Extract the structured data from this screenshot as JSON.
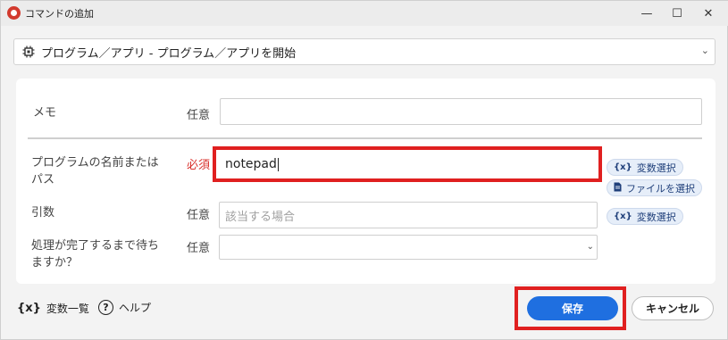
{
  "window": {
    "title": "コマンドの追加",
    "minimize_glyph": "—",
    "maximize_glyph": "☐",
    "close_glyph": "✕"
  },
  "command_select": {
    "icon": "chip-icon",
    "value": "プログラム／アプリ - プログラム／アプリを開始"
  },
  "fields": {
    "memo": {
      "label": "メモ",
      "tag": "任意",
      "value": ""
    },
    "program": {
      "label_line1": "プログラムの名前または",
      "label_line2": "パス",
      "tag": "必須",
      "value": "notepad"
    },
    "args": {
      "label": "引数",
      "tag": "任意",
      "placeholder": "該当する場合"
    },
    "wait": {
      "label_line1": "処理が完了するまで待ち",
      "label_line2": "ますか？",
      "tag": "任意",
      "value": ""
    }
  },
  "buttons": {
    "variable_select": "変数選択",
    "variable_select_icon_text": "{x}",
    "file_select": "ファイルを選択",
    "save": "保存",
    "cancel": "キャンセル"
  },
  "footer": {
    "variables_icon_text": "{x}",
    "variables_list": "変数一覧",
    "help_icon_text": "?",
    "help": "ヘルプ"
  },
  "colors": {
    "highlight": "#e02020",
    "primary": "#1f6fe0",
    "required": "#d9302b"
  }
}
